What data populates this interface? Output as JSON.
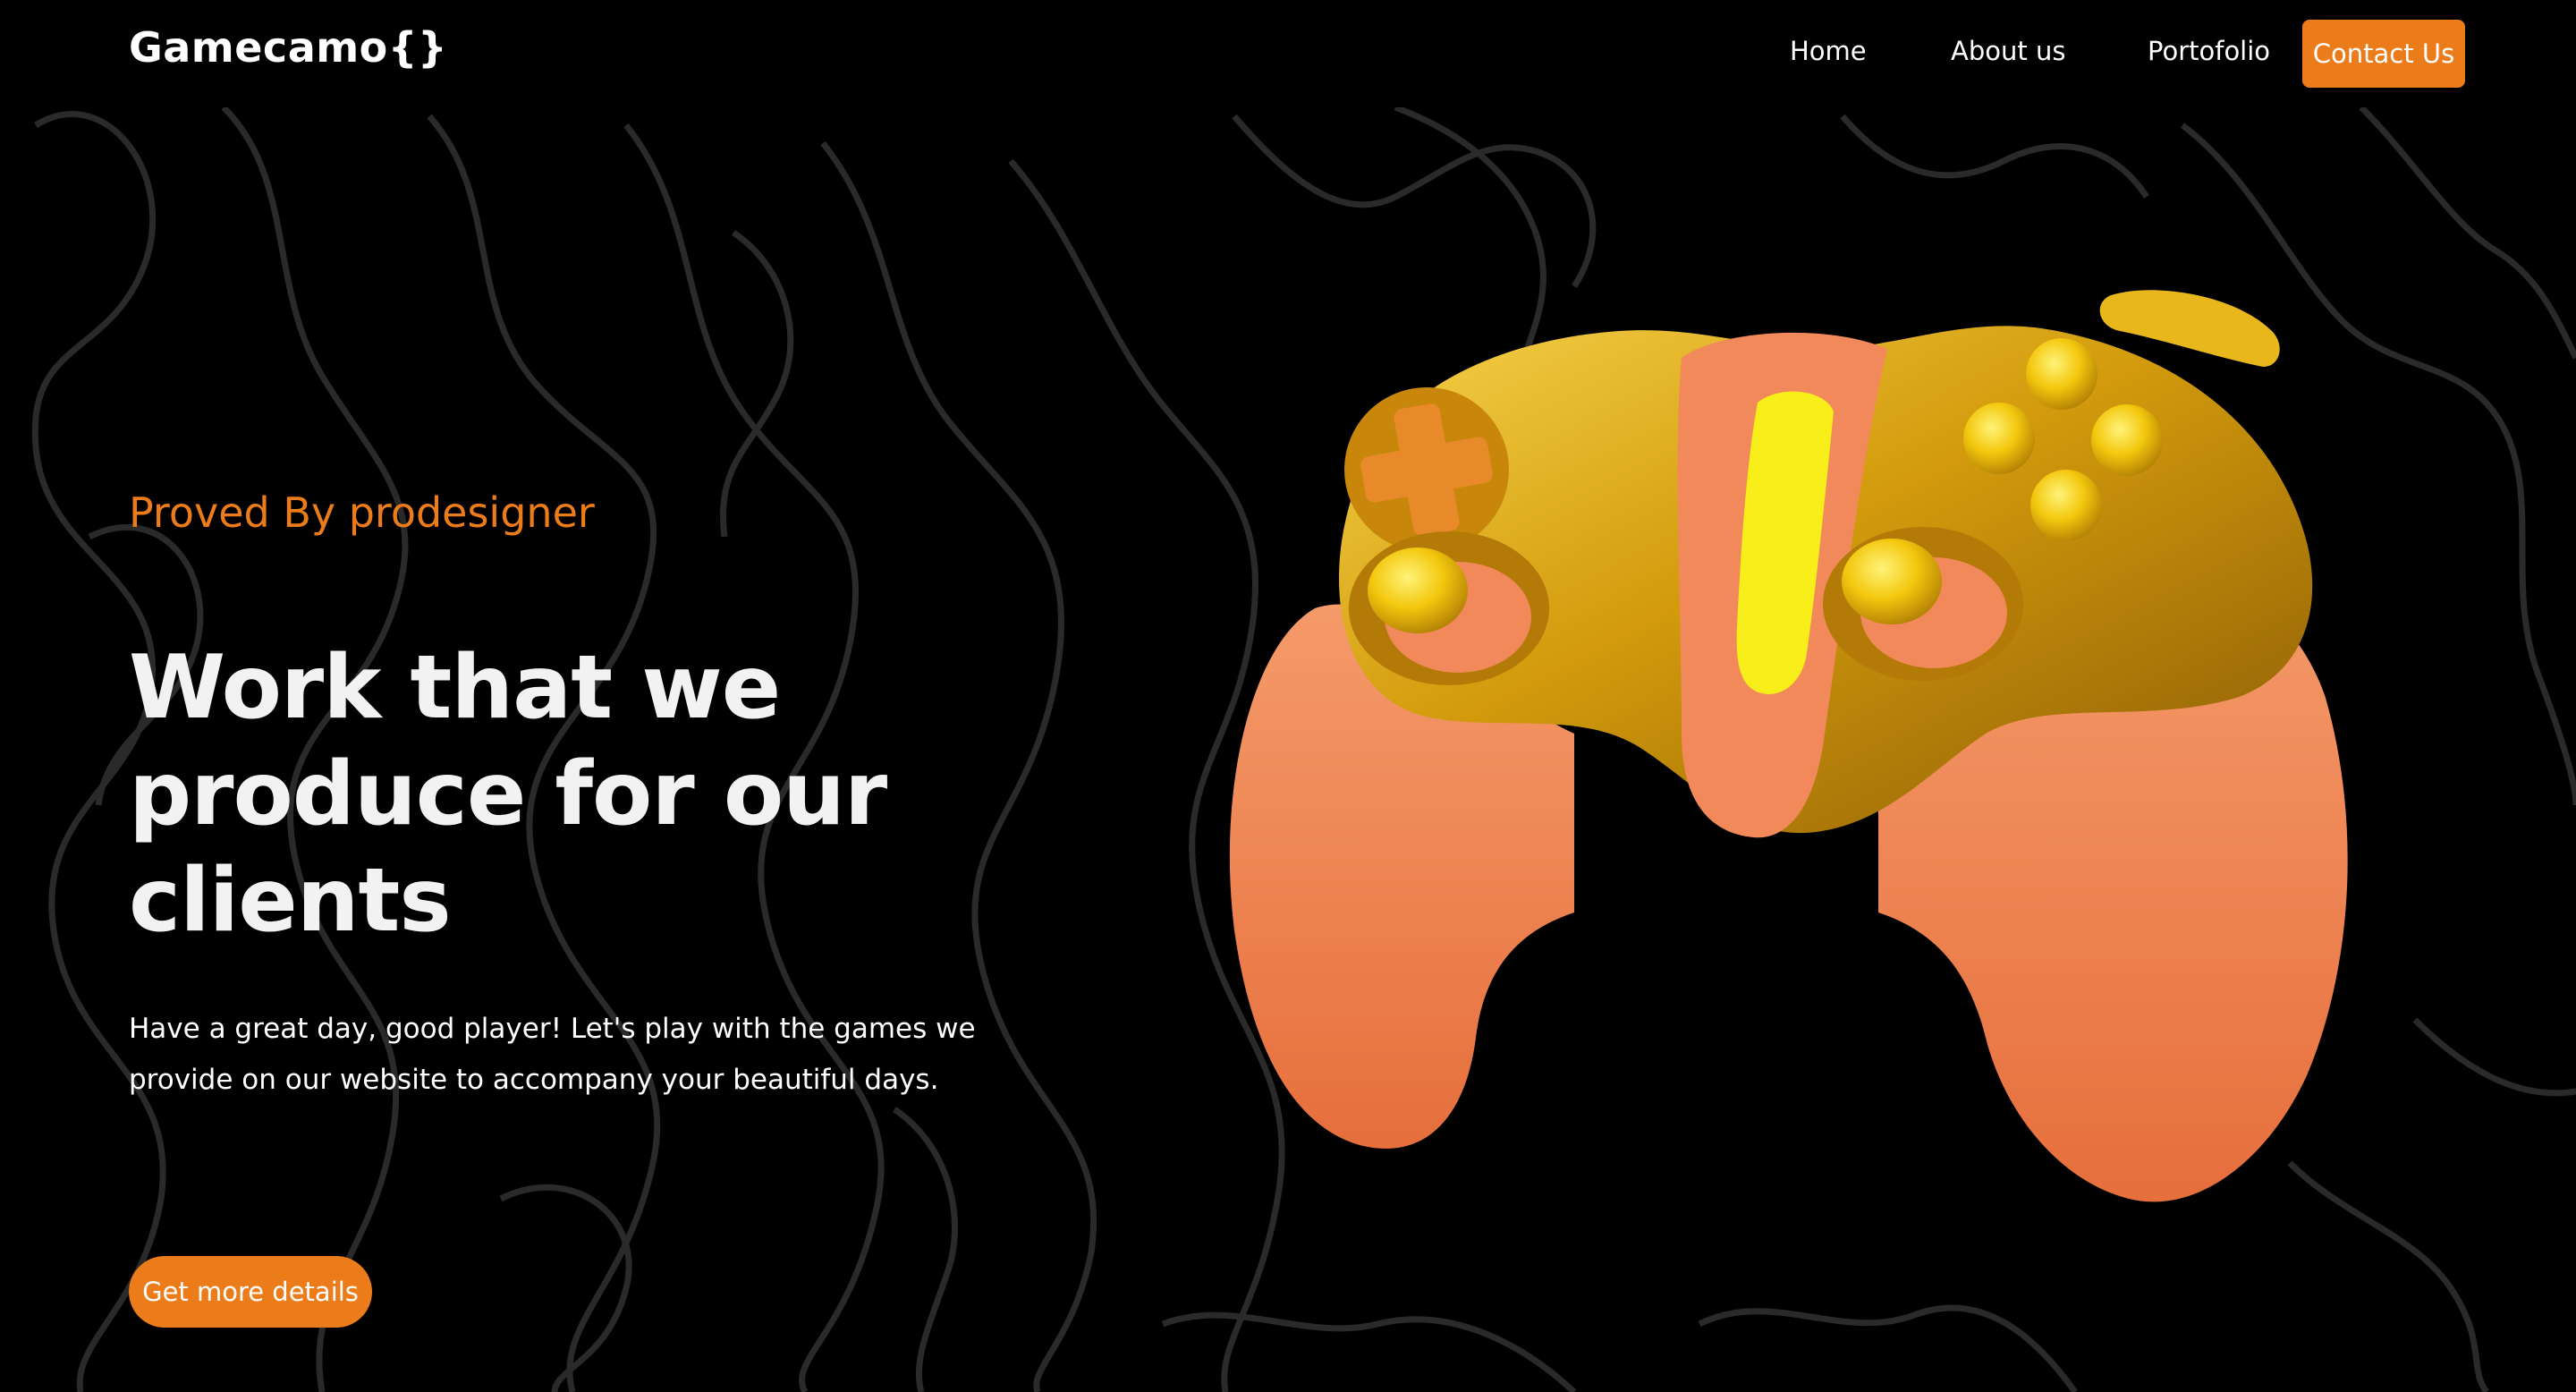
{
  "nav": {
    "logo": "Gamecamo{}",
    "links": [
      "Home",
      "About us",
      "Portofolio"
    ],
    "contact_label": "Contact Us"
  },
  "hero": {
    "eyebrow": "Proved By prodesigner",
    "headline_lines": [
      "Work that we",
      "produce for our",
      "clients"
    ],
    "subtext_lines": [
      "Have a great day, good player! Let's play with the games we",
      "provide on our website to accompany your beautiful days."
    ],
    "cta_label": "Get more details"
  },
  "colors": {
    "background": "#000000",
    "accent": "#ec7c1a",
    "text": "#ffffff",
    "contour_lines": "#2a2a2a",
    "controller_gold": "#d9a40f",
    "controller_peach": "#f0875a",
    "controller_glow": "#f8ef1a"
  },
  "images": {
    "hero_visual": "gamepad-3d-icon"
  }
}
